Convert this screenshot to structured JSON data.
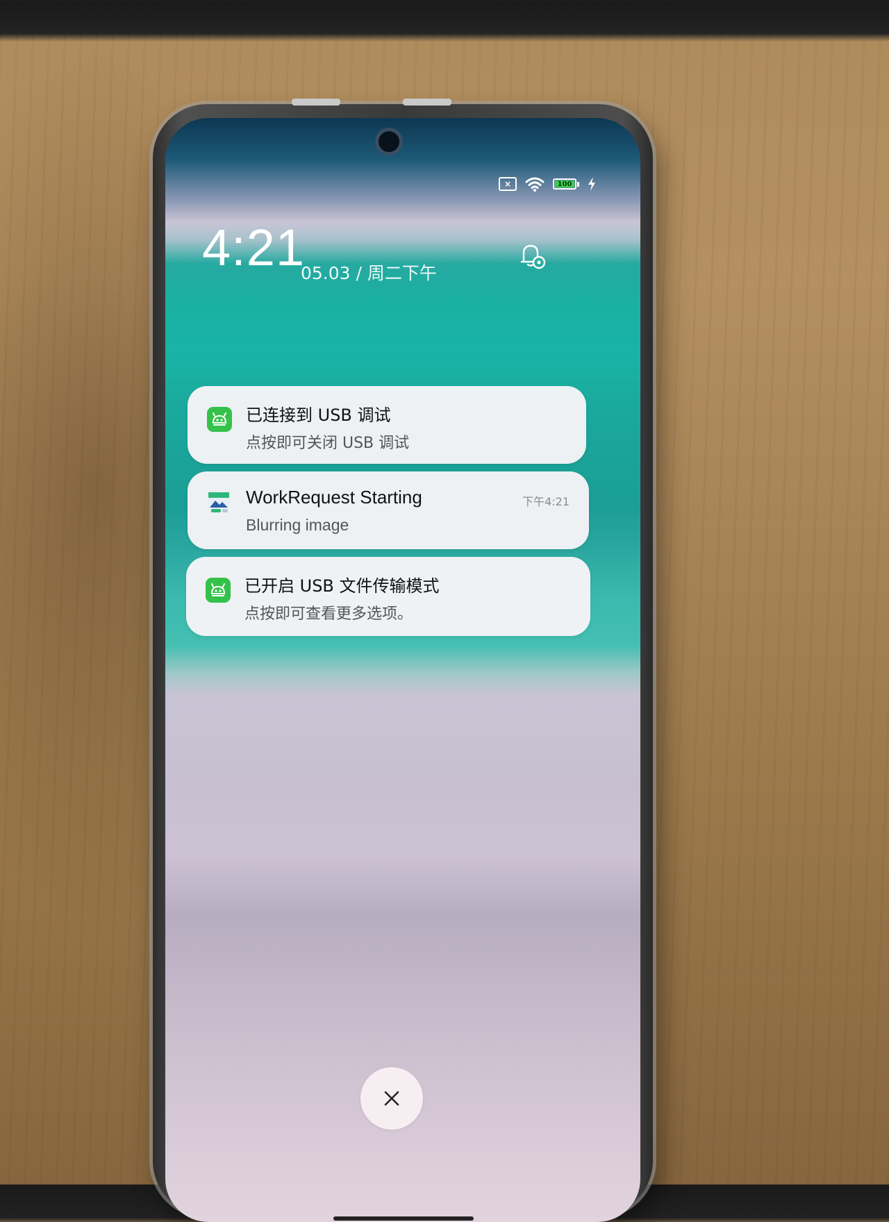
{
  "status_bar": {
    "battery_level": "100",
    "icons": [
      "sim-disabled-icon",
      "wifi-icon",
      "battery-icon",
      "charging-icon"
    ]
  },
  "lockscreen": {
    "time": "4:21",
    "date": "05.03 / 周二下午"
  },
  "notifications": [
    {
      "app_icon": "usb-debug-icon",
      "title": "已连接到 USB 调试",
      "body": "点按即可关闭 USB 调试",
      "time": ""
    },
    {
      "app_icon": "image-icon",
      "title": "WorkRequest Starting",
      "body": "Blurring image",
      "time": "下午4:21"
    },
    {
      "app_icon": "usb-transfer-icon",
      "title": "已开启 USB 文件传输模式",
      "body": "点按即可查看更多选项。",
      "time": ""
    }
  ],
  "colors": {
    "accent_green": "#35c24a",
    "battery_green": "#3bd14a"
  }
}
